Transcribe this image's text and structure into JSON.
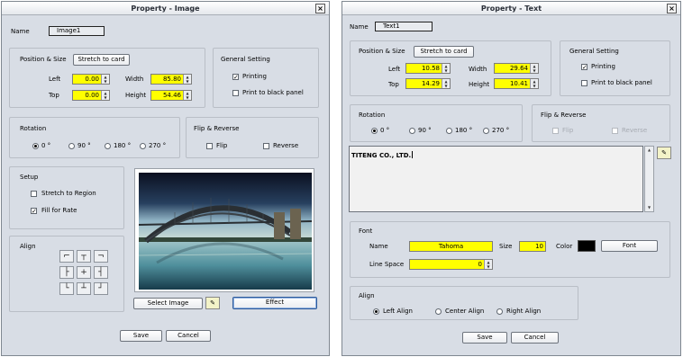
{
  "left": {
    "title": "Property - Image",
    "close": "×",
    "name_label": "Name",
    "name_value": "Image1",
    "position_group": "Position & Size",
    "stretch_btn": "Stretch to card",
    "left_label": "Left",
    "left_value": "0.00",
    "top_label": "Top",
    "top_value": "0.00",
    "width_label": "Width",
    "width_value": "85.80",
    "height_label": "Height",
    "height_value": "54.46",
    "general_group": "General Setting",
    "printing": "Printing",
    "print_black": "Print to black panel",
    "rotation_group": "Rotation",
    "rot0": "0 °",
    "rot90": "90 °",
    "rot180": "180 °",
    "rot270": "270 °",
    "flip_group": "Flip & Reverse",
    "flip": "Flip",
    "reverse": "Reverse",
    "setup_group": "Setup",
    "stretch_region": "Stretch to Region",
    "fill_rate": "Fill for Rate",
    "align_group": "Align",
    "align_cells": [
      "⌐",
      "┬",
      "¬",
      "├",
      "+",
      "┤",
      "└",
      "┴",
      "┘"
    ],
    "select_image": "Select Image",
    "effect": "Effect",
    "save": "Save",
    "cancel": "Cancel"
  },
  "right": {
    "title": "Property - Text",
    "close": "×",
    "name_label": "Name",
    "name_value": "Text1",
    "position_group": "Position & Size",
    "stretch_btn": "Stretch to card",
    "left_label": "Left",
    "left_value": "10.58",
    "top_label": "Top",
    "top_value": "14.29",
    "width_label": "Width",
    "width_value": "29.64",
    "height_label": "Height",
    "height_value": "10.41",
    "general_group": "General Setting",
    "printing": "Printing",
    "print_black": "Print to black panel",
    "rotation_group": "Rotation",
    "rot0": "0 °",
    "rot90": "90 °",
    "rot180": "180 °",
    "rot270": "270 °",
    "flip_group": "Flip & Reverse",
    "flip": "Flip",
    "reverse": "Reverse",
    "text_content": "TITENG CO., LTD.",
    "font_group": "Font",
    "font_name_label": "Name",
    "font_name": "Tahoma",
    "size_label": "Size",
    "size_value": "10",
    "color_label": "Color",
    "color_value": "#000000",
    "font_btn": "Font",
    "line_space_label": "Line Space",
    "line_space_value": "0",
    "align_group": "Align",
    "left_align": "Left Align",
    "center_align": "Center Align",
    "right_align": "Right Align",
    "save": "Save",
    "cancel": "Cancel"
  },
  "colors": {
    "dialog_bg": "#d8dde5",
    "field_highlight": "#ffff00",
    "focus_border": "#2d5a9b"
  }
}
